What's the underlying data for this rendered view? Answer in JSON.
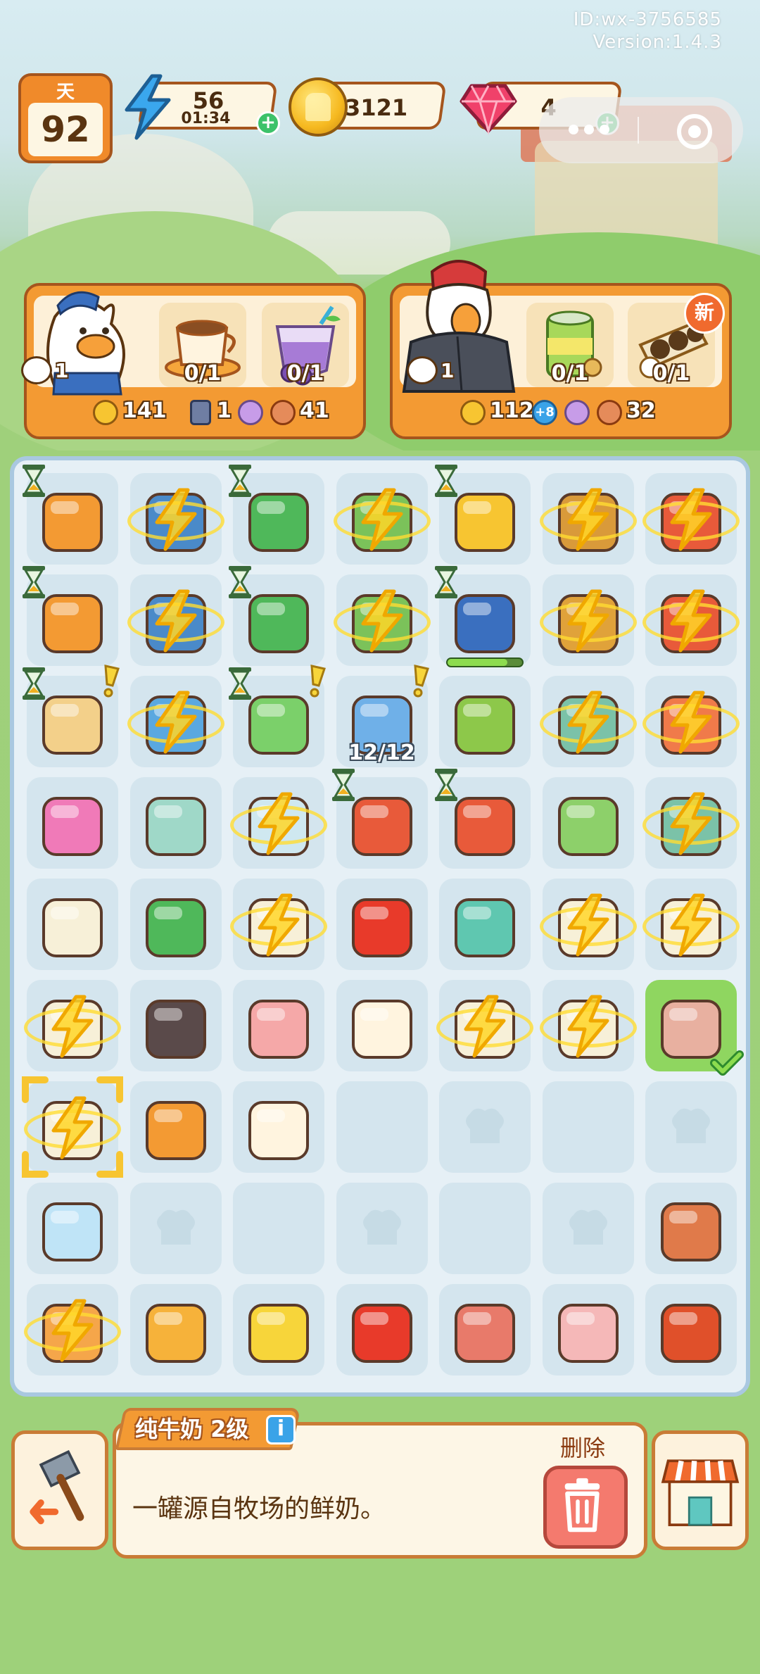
{
  "header": {
    "user_id": "ID:wx-3756585",
    "version": "Version:1.4.3",
    "day_label": "天",
    "day_value": "92",
    "energy_value": "56",
    "energy_timer": "01:34",
    "coin_value": "3121",
    "gem_value": "4",
    "plus_symbol": "+"
  },
  "orders": [
    {
      "hearts": "1",
      "items": [
        {
          "icon": "coffee-cup-icon",
          "progress": "0/1"
        },
        {
          "icon": "grape-drink-icon",
          "progress": "0/1"
        }
      ],
      "reward_coins": "141",
      "reward_card": "1",
      "reward_flowers": "",
      "reward_food": "41"
    },
    {
      "hearts": "1",
      "new_badge": "新",
      "items": [
        {
          "icon": "canned-drink-icon",
          "progress": "0/1"
        },
        {
          "icon": "sushi-roll-icon",
          "progress": "0/1"
        }
      ],
      "reward_coins": "112",
      "reward_bonus": "+8",
      "reward_flowers": "",
      "reward_food": "32"
    }
  ],
  "board": {
    "fridge_count": "12/12"
  },
  "info": {
    "item_name": "纯牛奶 2级",
    "info_icon": "i",
    "description": "一罐源自牧场的鲜奶。",
    "delete_label": "删除"
  },
  "colors": {
    "accent_orange": "#f39a33",
    "border_brown": "#a5551d",
    "board_bg": "#e6f0f6",
    "selected_green": "#8fd660"
  }
}
